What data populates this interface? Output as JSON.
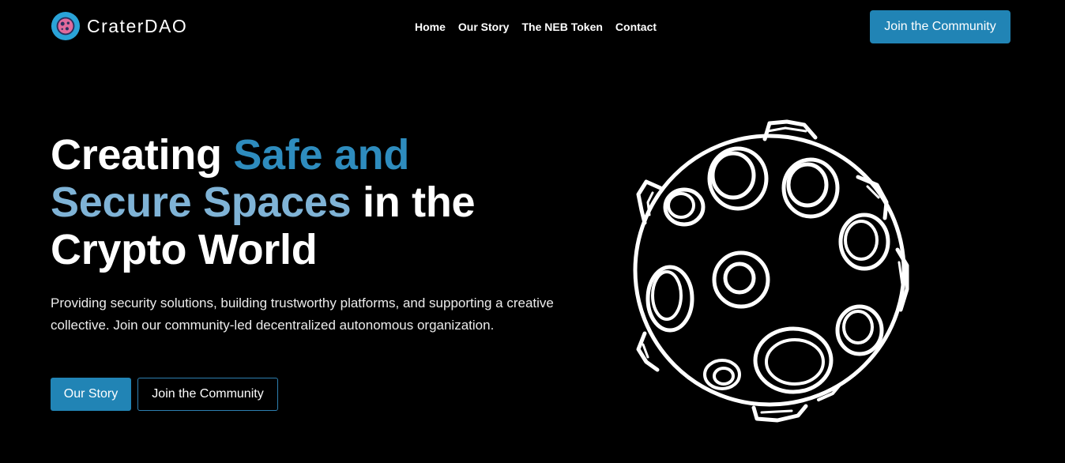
{
  "header": {
    "brand_name": "CraterDAO",
    "nav": [
      {
        "label": "Home"
      },
      {
        "label": "Our Story"
      },
      {
        "label": "The NEB Token"
      },
      {
        "label": "Contact"
      }
    ],
    "cta_label": "Join the Community"
  },
  "hero": {
    "title_part1": "Creating ",
    "title_accent1": "Safe and",
    "title_accent2": "Secure Spaces",
    "title_part2": " in the",
    "title_part3": "Crypto World",
    "description": "Providing security solutions, building trustworthy platforms, and supporting a creative collective. Join our community-led decentralized autonomous organization.",
    "primary_button": "Our Story",
    "secondary_button": "Join the Community"
  },
  "colors": {
    "background": "#000000",
    "accent": "#2184b5",
    "title_accent_dark": "#2e8cbe",
    "title_accent_light": "#7fb3d6"
  },
  "icons": {
    "logo": "crater-logo-icon",
    "illustration": "moon-crater-illustration"
  }
}
